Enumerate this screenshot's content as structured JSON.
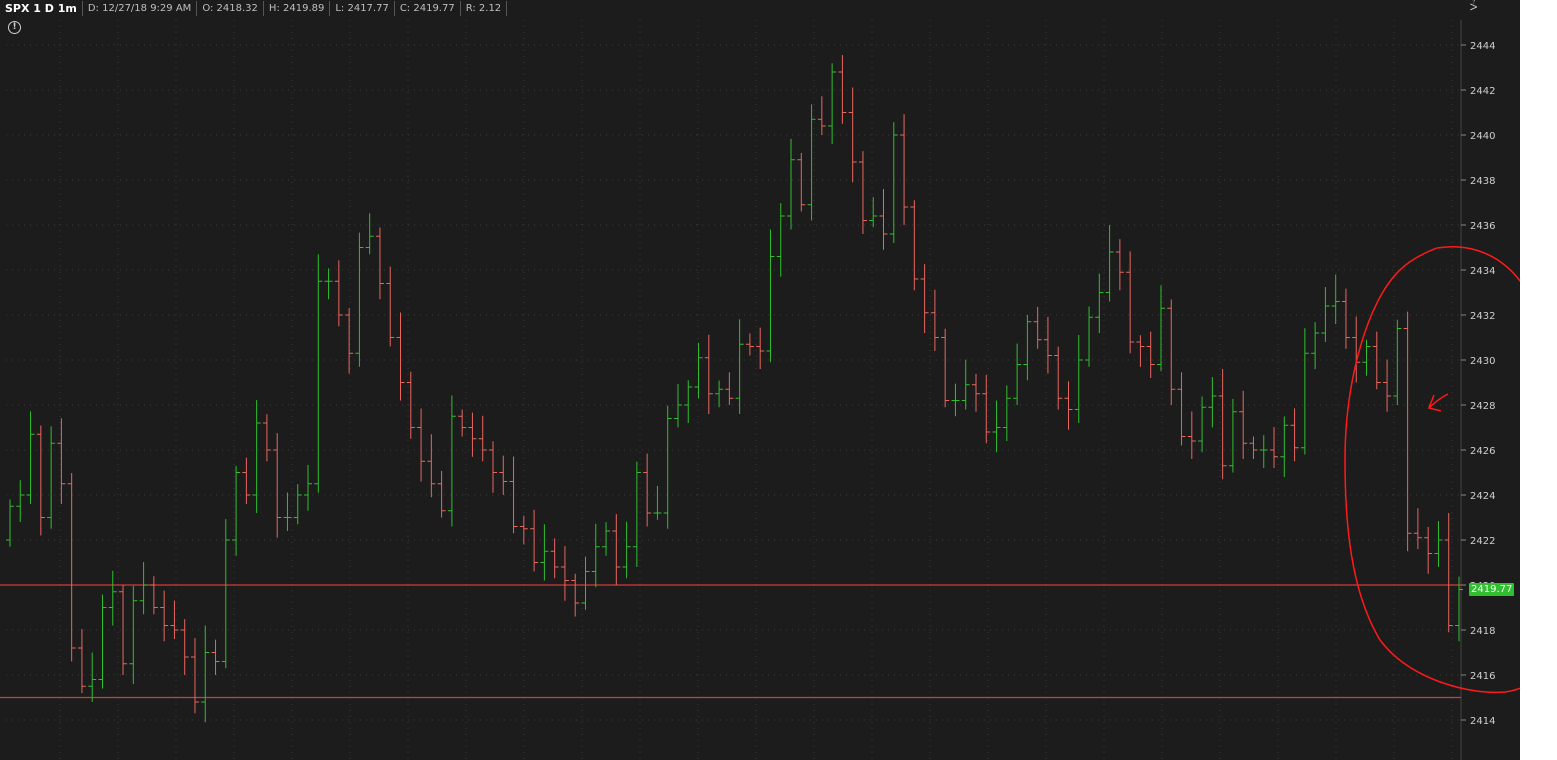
{
  "header": {
    "symbol": "SPX 1 D 1m",
    "date": "D: 12/27/18 9:29 AM",
    "open": "O: 2418.32",
    "high": "H: 2419.89",
    "low": "L: 2417.77",
    "close": "C: 2419.77",
    "range": "R: 2.12"
  },
  "price_tag": "2419.77",
  "icons": {
    "alert": "alert-circle-icon",
    "drawing": "drawing-tools-icon"
  },
  "colors": {
    "background": "#1c1c1c",
    "up": "#2fbf2f",
    "down": "#e9665f",
    "level_line": "#d43a3a",
    "annotation": "#ff1a1a"
  },
  "chart_data": {
    "type": "ohlc",
    "title": "SPX 1 D 1m",
    "ylim": [
      2413,
      2445
    ],
    "y_ticks": [
      2414,
      2416,
      2418,
      2420,
      2422,
      2424,
      2426,
      2428,
      2430,
      2432,
      2434,
      2436,
      2438,
      2440,
      2442,
      2444
    ],
    "y_tick_labels": [
      "2414",
      "2416",
      "2418",
      "2420",
      "2422",
      "2424",
      "2426",
      "2428",
      "2430",
      "2432",
      "2434",
      "2436",
      "2438",
      "2440",
      "2442",
      "2444"
    ],
    "grid": true,
    "horizontal_levels": [
      2420.0,
      2415.0
    ],
    "closes": [
      2423.5,
      2424.0,
      2426.7,
      2423.0,
      2426.3,
      2424.5,
      2417.2,
      2415.5,
      2415.8,
      2419.0,
      2419.7,
      2416.5,
      2419.3,
      2420.0,
      2419.0,
      2418.2,
      2418.0,
      2416.8,
      2414.8,
      2417.0,
      2416.6,
      2422.0,
      2425.0,
      2424.0,
      2427.2,
      2426.0,
      2423.0,
      2423.0,
      2424.0,
      2424.5,
      2433.5,
      2433.5,
      2432.0,
      2430.3,
      2435.0,
      2435.5,
      2433.4,
      2431.0,
      2429.0,
      2427.0,
      2425.5,
      2424.5,
      2423.3,
      2427.5,
      2427.0,
      2426.5,
      2426.0,
      2425.0,
      2424.6,
      2422.6,
      2422.5,
      2421.0,
      2421.5,
      2420.8,
      2420.2,
      2419.2,
      2420.6,
      2421.7,
      2422.4,
      2420.8,
      2421.7,
      2425.0,
      2423.2,
      2423.2,
      2427.4,
      2428.0,
      2428.8,
      2430.1,
      2428.5,
      2428.7,
      2428.3,
      2430.7,
      2430.6,
      2430.4,
      2434.6,
      2436.4,
      2438.9,
      2436.9,
      2440.7,
      2440.4,
      2442.8,
      2441.0,
      2438.8,
      2436.2,
      2436.4,
      2435.6,
      2440.0,
      2436.8,
      2433.6,
      2432.1,
      2431.0,
      2428.2,
      2428.2,
      2428.9,
      2428.5,
      2426.8,
      2427.0,
      2428.3,
      2429.8,
      2431.7,
      2430.9,
      2430.2,
      2428.3,
      2427.8,
      2430.0,
      2431.9,
      2433.0,
      2434.8,
      2433.9,
      2430.8,
      2430.6,
      2429.8,
      2432.3,
      2428.7,
      2426.6,
      2426.4,
      2427.9,
      2428.4,
      2425.3,
      2427.7,
      2426.3,
      2426.0,
      2426.0,
      2425.7,
      2427.1,
      2426.1,
      2430.3,
      2431.2,
      2432.4,
      2432.6,
      2431.0,
      2429.9,
      2430.6,
      2429.0,
      2428.4,
      2431.4,
      2422.3,
      2422.1,
      2421.4,
      2422.0,
      2418.2,
      2419.8
    ],
    "open_label": "O: 2418.32",
    "close_label": "C: 2419.77",
    "annotations": [
      "circle around last 9 bars",
      "arrow pointing at drop bar"
    ]
  }
}
